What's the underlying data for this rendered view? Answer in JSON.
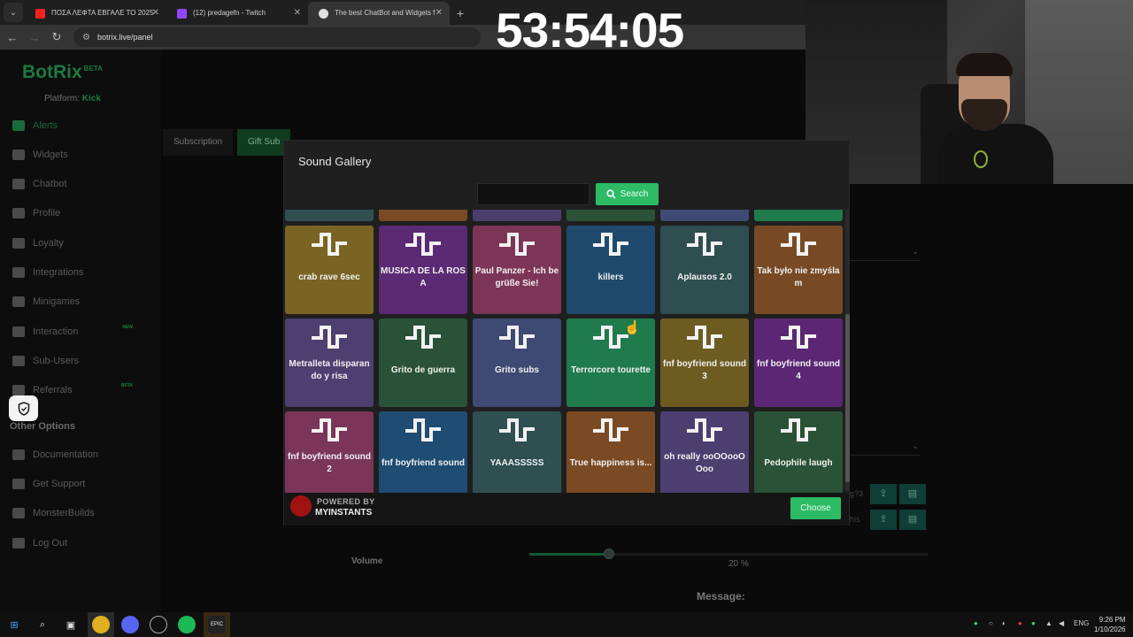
{
  "browser": {
    "tabs": [
      {
        "title": "ΠΟΣΑ ΛΕΦΤΑ ΕΒΓΑΛΕ ΤΟ 2025",
        "favicon_color": "#ff2020"
      },
      {
        "title": "(12) predagefn - Twitch",
        "favicon_color": "#9146ff"
      },
      {
        "title": "The best ChatBot and Widgets f",
        "favicon_color": "#e0e0e0"
      }
    ],
    "new_tab": "+",
    "url": "botrix.live/panel"
  },
  "timer": "53:54:05",
  "sidebar": {
    "brand": "BotRix",
    "brand_badge": "BETA",
    "platform_label": "Platform:",
    "platform_value": "Kick",
    "items": [
      {
        "label": "Alerts"
      },
      {
        "label": "Widgets"
      },
      {
        "label": "Chatbot"
      },
      {
        "label": "Profile"
      },
      {
        "label": "Loyalty"
      },
      {
        "label": "Integrations"
      },
      {
        "label": "Minigames"
      },
      {
        "label": "Interaction",
        "badge": "NEW"
      },
      {
        "label": "Sub-Users"
      },
      {
        "label": "Referrals",
        "badge": "BETA"
      }
    ],
    "other_options": "Other Options",
    "other_items": [
      {
        "label": "Documentation"
      },
      {
        "label": "Get Support"
      },
      {
        "label": "MonsterBuilds"
      },
      {
        "label": "Log Out"
      }
    ]
  },
  "panel": {
    "tabs": [
      "Subscription",
      "Gift Sub"
    ],
    "volume_label": "Volume",
    "volume_value": "20 %",
    "message_label": "Message:",
    "right_fragment_1": "g?3",
    "right_fragment_2": "his"
  },
  "modal": {
    "title": "Sound Gallery",
    "search_button": "Search",
    "search_value": "",
    "tiles": [
      {
        "label": "crab rave 6sec",
        "color": "#7a6424"
      },
      {
        "label": "MUSICA DE LA ROSA",
        "color": "#5c2a74"
      },
      {
        "label": "Paul Panzer - Ich begrüße Sie!",
        "color": "#7c3556"
      },
      {
        "label": "killers",
        "color": "#1f4a6e"
      },
      {
        "label": "Aplausos 2.0",
        "color": "#2f4e4f"
      },
      {
        "label": "Tak było nie zmyślam",
        "color": "#774a25"
      },
      {
        "label": "Metralleta disparando y risa",
        "color": "#4d3f70"
      },
      {
        "label": "Grito de guerra",
        "color": "#2a5238"
      },
      {
        "label": "Grito subs",
        "color": "#3e4a74"
      },
      {
        "label": "Terrorcore tourette",
        "color": "#1f7a4c"
      },
      {
        "label": "fnf boyfriend sound 3",
        "color": "#6e5b22"
      },
      {
        "label": "fnf boyfriend sound 4",
        "color": "#5b2774"
      },
      {
        "label": "fnf boyfriend sound 2",
        "color": "#7a3558"
      },
      {
        "label": "fnf boyfriend sound",
        "color": "#1f4c73"
      },
      {
        "label": "YAAASSSSS",
        "color": "#2f4f50"
      },
      {
        "label": "True happiness is...",
        "color": "#7a4a24"
      },
      {
        "label": "oh really ooOOooOOoo",
        "color": "#4b3f70"
      },
      {
        "label": "Pedophile laugh",
        "color": "#2a5236"
      }
    ],
    "partial_row_colors": [
      "#2f4f50",
      "#7a4a24",
      "#4b3f70",
      "#2a5236",
      "#3e4a74",
      "#1f7a4c"
    ],
    "powered_by": "POWERED BY",
    "provider": "MYINSTANTS",
    "choose_button": "Choose"
  },
  "taskbar": {
    "language": "ENG",
    "time": "9:26 PM",
    "date": "1/10/2026"
  },
  "colors": {
    "accent_green": "#2dbb66",
    "brand_green": "#1a7a40"
  }
}
